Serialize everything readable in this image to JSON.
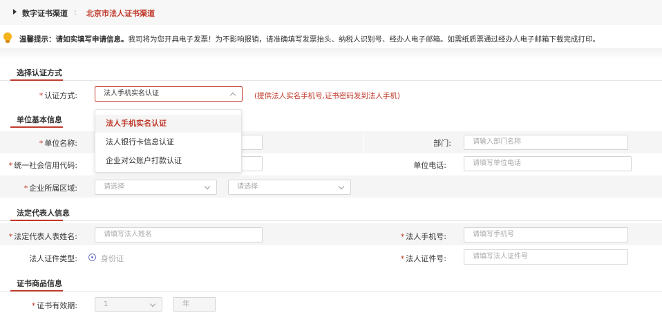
{
  "breadcrumb": {
    "parent": "数字证书渠道",
    "separator": ":",
    "current": "北京市法人证书渠道"
  },
  "notice": {
    "icon": "lightbulb-icon",
    "bold_text": "温馨提示：请如实填写申请信息。",
    "text": "我司将为您开具电子发票！为不影响报销，请准确填写发票抬头、纳税人识别号、经办人电子邮箱。如需纸质票通过经办人电子邮箱下载完成打印。"
  },
  "sections": {
    "auth": "选择认证方式",
    "unit": "单位基本信息",
    "legal": "法定代表人信息",
    "cert": "证书商品信息"
  },
  "required_mark": "*",
  "auth": {
    "label": "认证方式:",
    "selected": "法人手机实名认证",
    "hint": "(提供法人实名手机号,证书密码发到法人手机)",
    "options": [
      "法人手机实名认证",
      "法人银行卡信息认证",
      "企业对公账户打款认证"
    ]
  },
  "unit": {
    "name_label": "单位名称:",
    "department_label": "部门:",
    "department_placeholder": "请输入部门名称",
    "credit_code_label": "统一社会信用代码:",
    "phone_label": "单位电话:",
    "phone_placeholder": "请填写单位电话",
    "region_label": "企业所属区域:",
    "region_placeholder_1": "请选择",
    "region_placeholder_2": "请选择"
  },
  "legal": {
    "name_label": "法定代表人表姓名:",
    "name_placeholder": "请填写法人姓名",
    "mobile_label": "法人手机号:",
    "mobile_placeholder": "请填写手机号",
    "id_type_label": "法人证件类型:",
    "id_type_value": "身份证",
    "id_no_label": "法人证件号:",
    "id_no_placeholder": "请填写法人证件号"
  },
  "cert": {
    "validity_label": "证书有效期:",
    "validity_value": "1",
    "validity_unit": "年"
  },
  "colors": {
    "accent": "#c0392b",
    "row_bg": "#f5f5f5",
    "radio": "#6a73c9"
  }
}
